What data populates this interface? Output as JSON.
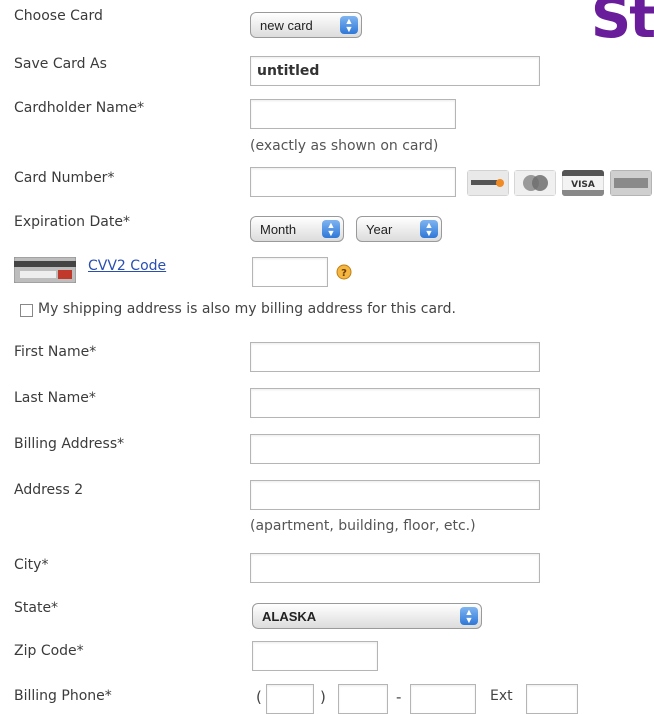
{
  "logo": {
    "text": "St"
  },
  "choose_card": {
    "label": "Choose Card",
    "selected": "new card"
  },
  "save_card_as": {
    "label": "Save Card As",
    "value": "untitled"
  },
  "cardholder_name": {
    "label": "Cardholder Name*",
    "value": "",
    "hint": "(exactly as shown on card)"
  },
  "card_number": {
    "label": "Card Number*",
    "value": "",
    "accepted_icons": [
      "discover-icon",
      "mastercard-icon",
      "visa-icon",
      "amex-icon"
    ]
  },
  "expiration_date": {
    "label": "Expiration Date*",
    "month": "Month",
    "year": "Year"
  },
  "cvv2": {
    "link": "CVV2 Code",
    "value": ""
  },
  "shipping_checkbox": {
    "label": "My shipping address is also my billing address for this card.",
    "checked": false
  },
  "first_name": {
    "label": "First Name*",
    "value": ""
  },
  "last_name": {
    "label": "Last Name*",
    "value": ""
  },
  "billing_address": {
    "label": "Billing Address*",
    "value": ""
  },
  "address2": {
    "label": "Address 2",
    "value": "",
    "hint": "(apartment, building, floor, etc.)"
  },
  "city": {
    "label": "City*",
    "value": ""
  },
  "state": {
    "label": "State*",
    "selected": "ALASKA"
  },
  "zip": {
    "label": "Zip Code*",
    "value": ""
  },
  "billing_phone": {
    "label": "Billing Phone*",
    "open_paren": "(",
    "close_paren": ")",
    "dash": "-",
    "ext_label": "Ext"
  },
  "colors": {
    "logo": "#6a1d9a",
    "link": "#2a4fb0",
    "select_arrow": "#2f78d8"
  }
}
